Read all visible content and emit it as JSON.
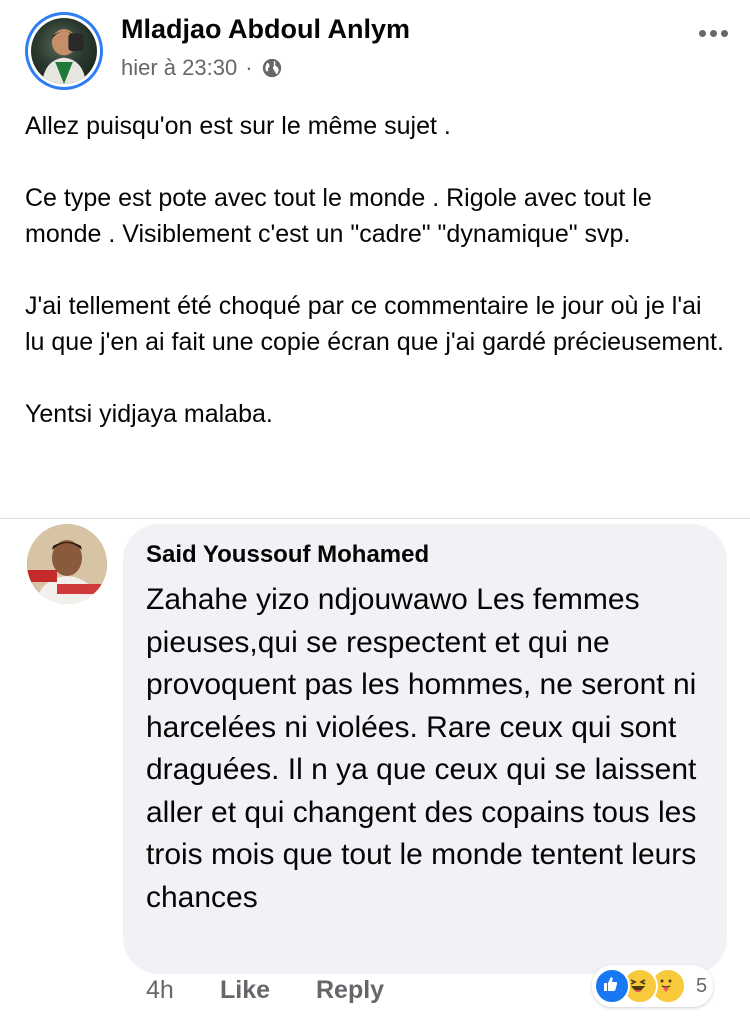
{
  "post": {
    "author": "Mladjao Abdoul Anlym",
    "time": "hier à 23:30",
    "separator": "·",
    "audience_icon": "globe-icon",
    "menu_icon": "more-options-icon",
    "paragraphs": [
      "Allez puisqu'on est sur le même sujet .",
      "Ce type est pote avec tout le monde .  Rigole avec tout le monde . Visiblement c'est un \"cadre\" \"dynamique\" svp.",
      "J'ai tellement été choqué par ce commentaire le jour où je l'ai lu que j'en ai fait une copie écran que j'ai gardé précieusement.",
      "Yentsi yidjaya malaba."
    ]
  },
  "comment": {
    "author": "Said Youssouf Mohamed",
    "text": "Zahahe yizo ndjouwawo Les femmes pieuses,qui se respectent et qui ne provoquent pas les hommes, ne seront  ni harcelées ni violées. Rare ceux qui sont draguées. Il n ya que ceux qui se laissent aller et qui changent des copains tous les trois mois que tout le monde tentent leurs chances",
    "time": "4h",
    "like_label": "Like",
    "reply_label": "Reply",
    "reactions": [
      "like-icon",
      "haha-icon",
      "care-icon"
    ],
    "reaction_count": "5"
  },
  "colors": {
    "text_primary": "#050505",
    "text_secondary": "#65676b",
    "bubble_bg": "#f0f2f5",
    "story_ring": "#2e7cf6",
    "like_blue": "#1877f2",
    "emoji_yellow": "#f7c93b"
  }
}
